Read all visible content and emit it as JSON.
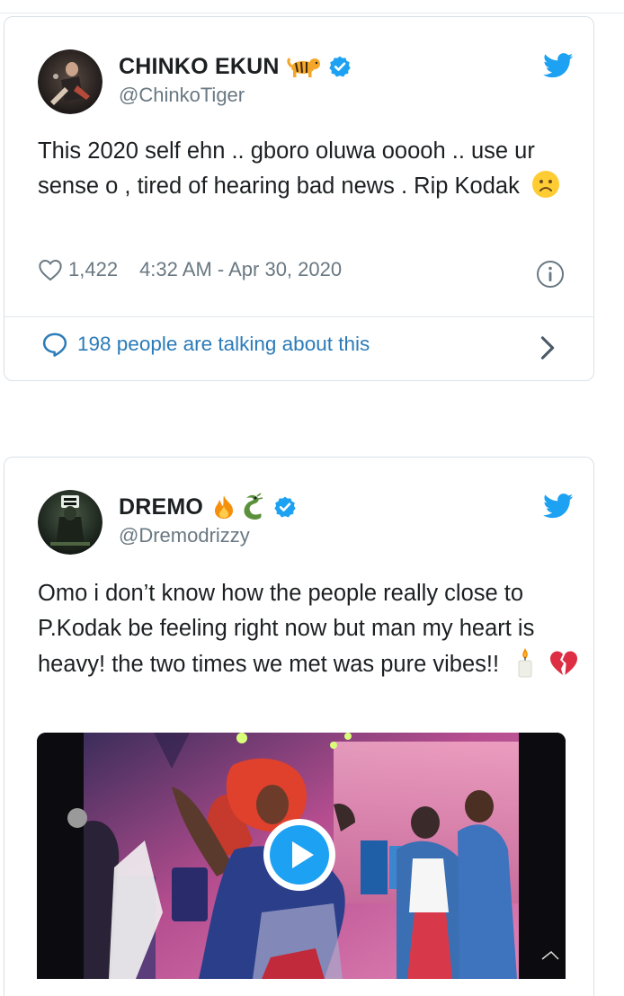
{
  "tweets": [
    {
      "name": "CHINKO EKUN",
      "name_emoji": "tiger",
      "handle": "@ChinkoTiger",
      "text": "This 2020 self ehn .. gboro oluwa ooooh .. use ur sense o , tired of hearing bad news . Rip Kodak",
      "text_emoji": "frowning-face",
      "likes": "1,422",
      "timestamp": "4:32 AM - Apr 30, 2020",
      "talking": "198 people are talking about this"
    },
    {
      "name": "DREMO",
      "name_emoji": "fire dragon",
      "handle": "@Dremodrizzy",
      "text": "Omo i don’t know how the people really close to P.Kodak be feeling right now but man my heart is heavy! the two times we met was pure vibes!!",
      "text_emoji": "candle broken-heart",
      "media": "video"
    }
  ],
  "colors": {
    "twitter_blue": "#1da1f2",
    "link_blue": "#2b7bb9",
    "meta_gray": "#697882",
    "text": "#1c2022",
    "border": "#d9e1e6"
  },
  "icons": [
    "verified-badge-icon",
    "twitter-bird-icon",
    "heart-icon",
    "info-icon",
    "speech-bubble-icon",
    "chevron-right-icon",
    "play-icon"
  ]
}
